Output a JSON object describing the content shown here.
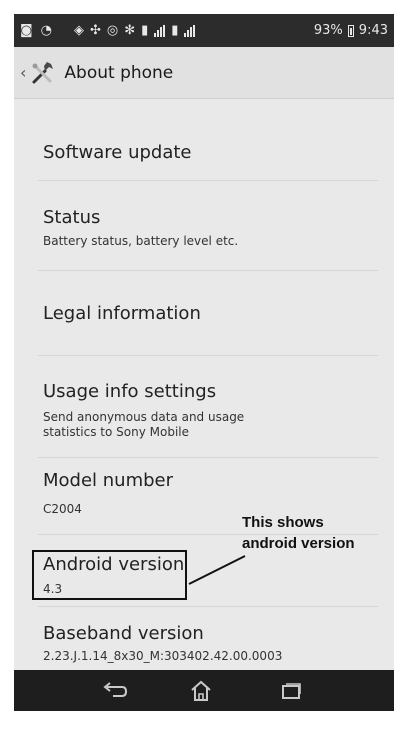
{
  "status_bar": {
    "battery_percent": "93%",
    "time": "9:43"
  },
  "action_bar": {
    "back_glyph": "‹",
    "icon": "tools-icon",
    "title": "About phone"
  },
  "items": [
    {
      "title": "Software update",
      "subtitle": ""
    },
    {
      "title": "Status",
      "subtitle": "Battery status, battery level etc."
    },
    {
      "title": "Legal information",
      "subtitle": ""
    },
    {
      "title": "Usage info settings",
      "subtitle": "Send anonymous data and usage\nstatistics to Sony Mobile"
    },
    {
      "title": "Model number",
      "subtitle": "C2004"
    },
    {
      "title": "Android version",
      "subtitle": "4.3"
    },
    {
      "title": "Baseband version",
      "subtitle": "2.23.J.1.14_8x30_M:303402.42.00.0003"
    }
  ],
  "annotation": {
    "line1": "This shows",
    "line2": "android version"
  },
  "nav_bar": {
    "back": "back-icon",
    "home": "home-icon",
    "recents": "recents-icon"
  },
  "colors": {
    "status_bar": "#2c2c2c",
    "action_bar": "#e1e1e1",
    "list_bg": "#e9e9e9",
    "nav_bar": "#1e1e1e"
  }
}
